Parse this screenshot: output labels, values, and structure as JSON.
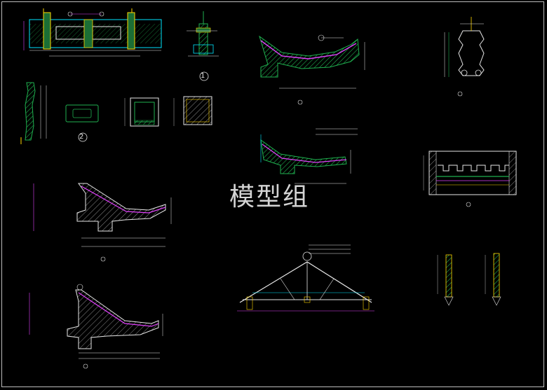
{
  "watermark": "模型组",
  "palette": {
    "background": "#000000",
    "hatch": "#00c853",
    "section_green": "#23a04a",
    "magenta": "#e040fb",
    "cyan": "#00e5ff",
    "white": "#e6e6e6",
    "yellow": "#ffd600",
    "red": "#ff3b30"
  },
  "callouts": {
    "circle1": "1",
    "circle2": "2"
  }
}
